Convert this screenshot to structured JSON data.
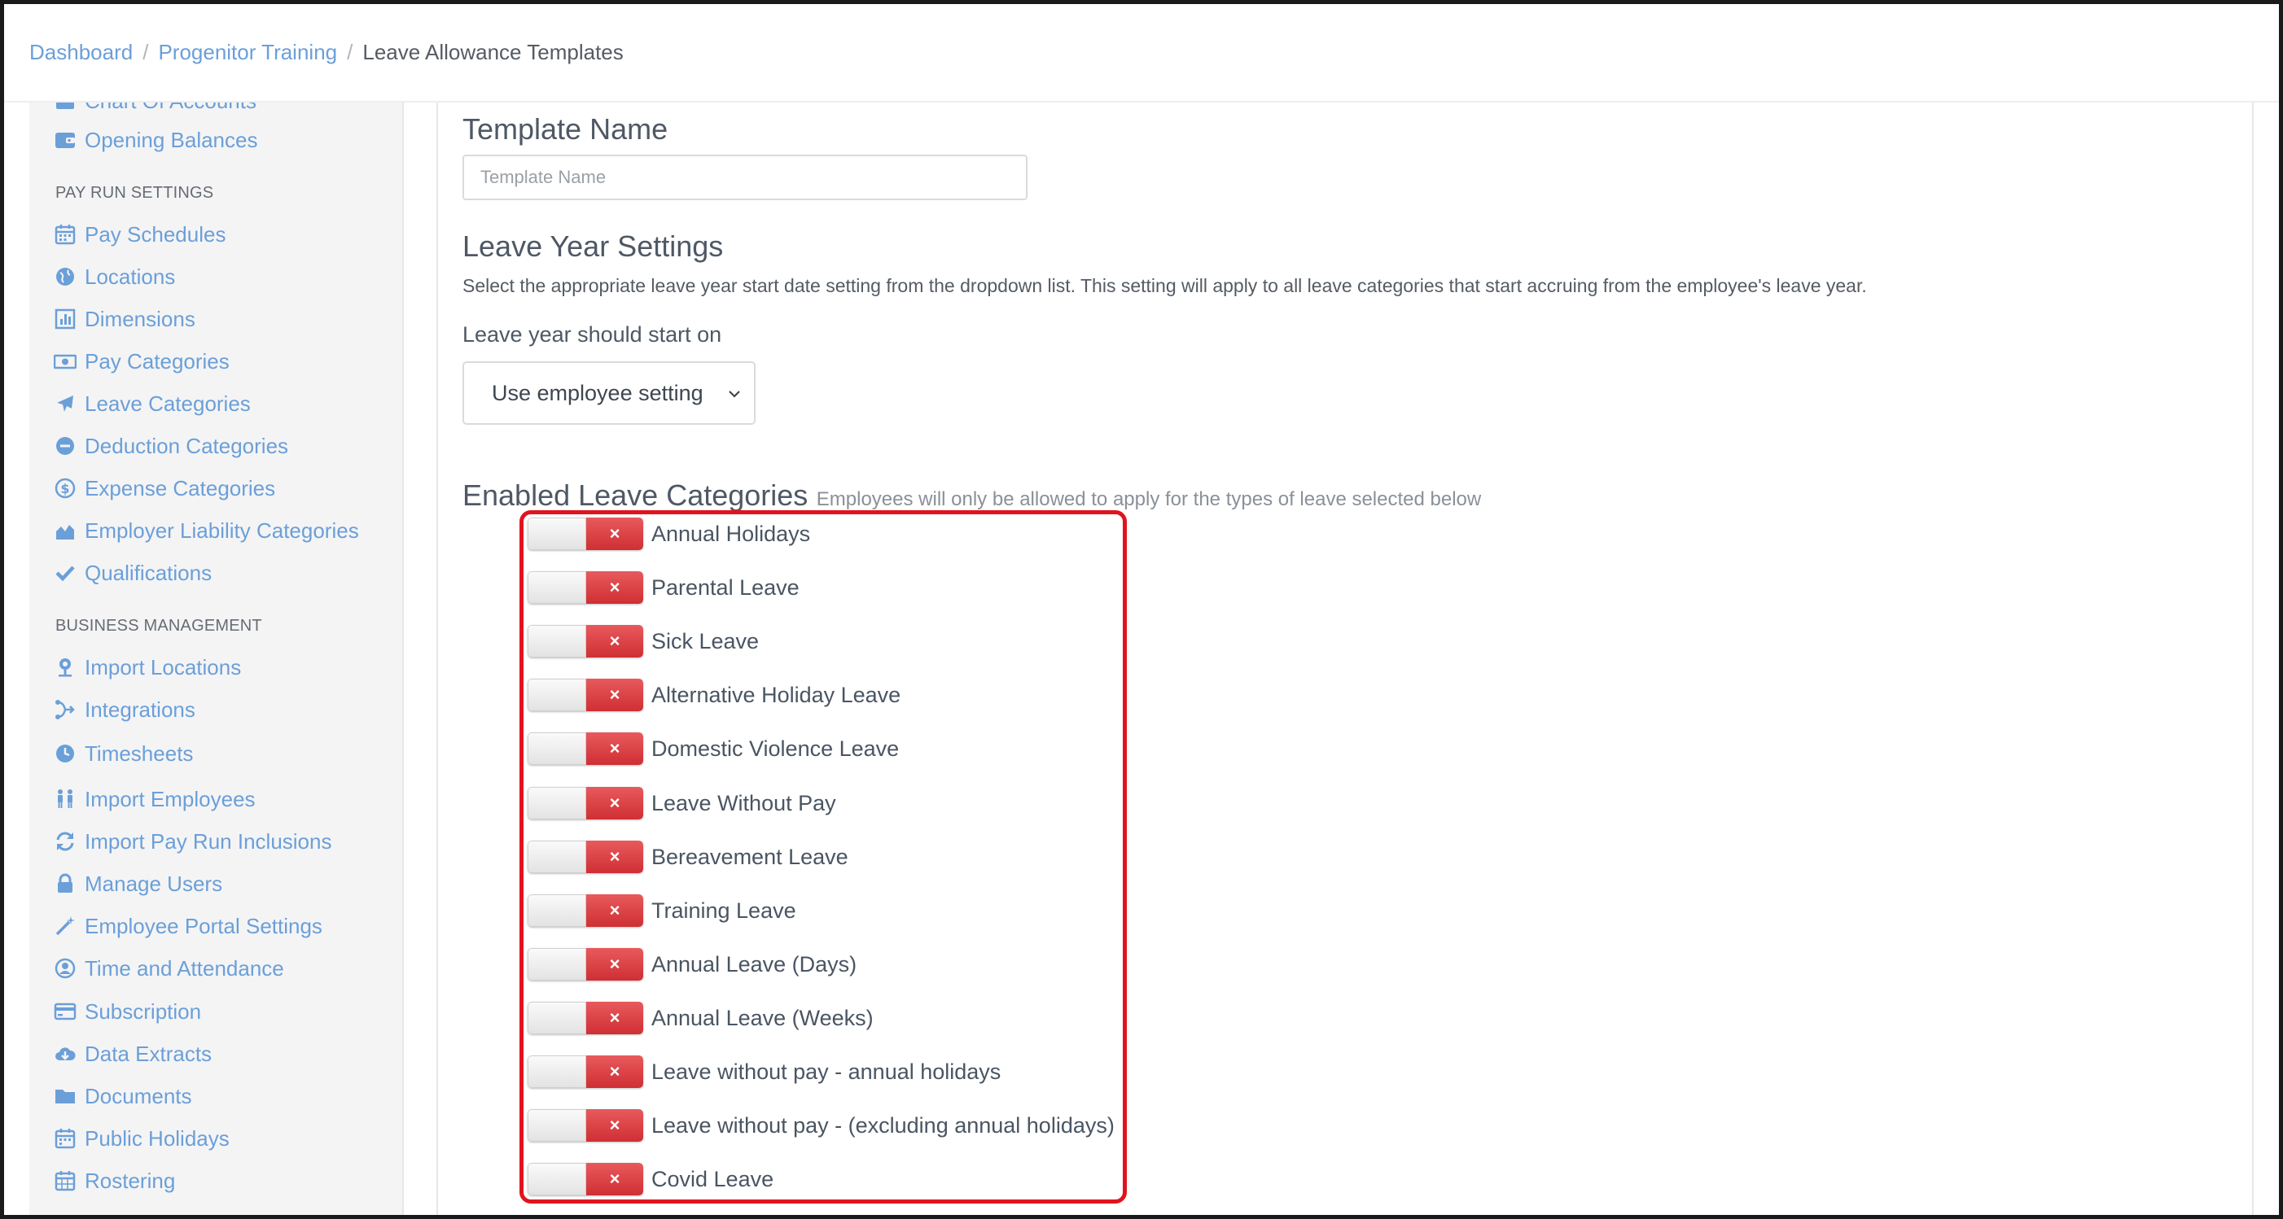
{
  "breadcrumb": {
    "items": [
      "Dashboard",
      "Progenitor Training"
    ],
    "current": "Leave Allowance Templates"
  },
  "sidebar": {
    "partial_top": "Chart Of Accounts",
    "top_items": [
      {
        "label": "Opening Balances",
        "icon": "wallet-icon"
      }
    ],
    "sections": [
      {
        "heading": "PAY RUN SETTINGS",
        "items": [
          {
            "label": "Pay Schedules",
            "icon": "calendar-icon"
          },
          {
            "label": "Locations",
            "icon": "globe-icon"
          },
          {
            "label": "Dimensions",
            "icon": "bar-chart-icon"
          },
          {
            "label": "Pay Categories",
            "icon": "money-icon"
          },
          {
            "label": "Leave Categories",
            "icon": "plane-icon"
          },
          {
            "label": "Deduction Categories",
            "icon": "minus-circle-icon"
          },
          {
            "label": "Expense Categories",
            "icon": "dollar-circle-icon"
          },
          {
            "label": "Employer Liability Categories",
            "icon": "area-chart-icon"
          },
          {
            "label": "Qualifications",
            "icon": "check-icon"
          }
        ]
      },
      {
        "heading": "BUSINESS MANAGEMENT",
        "items": [
          {
            "label": "Import Locations",
            "icon": "map-pin-icon"
          },
          {
            "label": "Integrations",
            "icon": "integrations-icon"
          },
          {
            "label": "Timesheets",
            "icon": "clock-icon"
          },
          {
            "label": "Import Employees",
            "icon": "people-icon"
          },
          {
            "label": "Import Pay Run Inclusions",
            "icon": "refresh-icon"
          },
          {
            "label": "Manage Users",
            "icon": "lock-icon"
          },
          {
            "label": "Employee Portal Settings",
            "icon": "magic-wand-icon"
          },
          {
            "label": "Time and Attendance",
            "icon": "user-circle-icon"
          },
          {
            "label": "Subscription",
            "icon": "credit-card-icon"
          },
          {
            "label": "Data Extracts",
            "icon": "cloud-download-icon"
          },
          {
            "label": "Documents",
            "icon": "folder-icon"
          },
          {
            "label": "Public Holidays",
            "icon": "calendar-icon"
          },
          {
            "label": "Rostering",
            "icon": "calendar-grid-icon"
          }
        ]
      }
    ]
  },
  "main": {
    "template_name": {
      "heading": "Template Name",
      "placeholder": "Template Name",
      "value": ""
    },
    "leave_year": {
      "heading": "Leave Year Settings",
      "description": "Select the appropriate leave year start date setting from the dropdown list. This setting will apply to all leave categories that start accruing from the employee's leave year.",
      "label": "Leave year should start on",
      "selected": "Use employee setting"
    },
    "enabled": {
      "heading": "Enabled Leave Categories",
      "subheading": "Employees will only be allowed to apply for the types of leave selected below",
      "toggle_off_symbol": "×",
      "categories": [
        {
          "label": "Annual Holidays",
          "enabled": false
        },
        {
          "label": "Parental Leave",
          "enabled": false
        },
        {
          "label": "Sick Leave",
          "enabled": false
        },
        {
          "label": "Alternative Holiday Leave",
          "enabled": false
        },
        {
          "label": "Domestic Violence Leave",
          "enabled": false
        },
        {
          "label": "Leave Without Pay",
          "enabled": false
        },
        {
          "label": "Bereavement Leave",
          "enabled": false
        },
        {
          "label": "Training Leave",
          "enabled": false
        },
        {
          "label": "Annual Leave (Days)",
          "enabled": false
        },
        {
          "label": "Annual Leave (Weeks)",
          "enabled": false
        },
        {
          "label": "Leave without pay - annual holidays",
          "enabled": false
        },
        {
          "label": "Leave without pay - (excluding annual holidays)",
          "enabled": false
        },
        {
          "label": "Covid Leave",
          "enabled": false
        }
      ]
    }
  },
  "colors": {
    "link": "#6b9fd8",
    "toggle_off": "#d9363a",
    "highlight": "#e0141e"
  }
}
